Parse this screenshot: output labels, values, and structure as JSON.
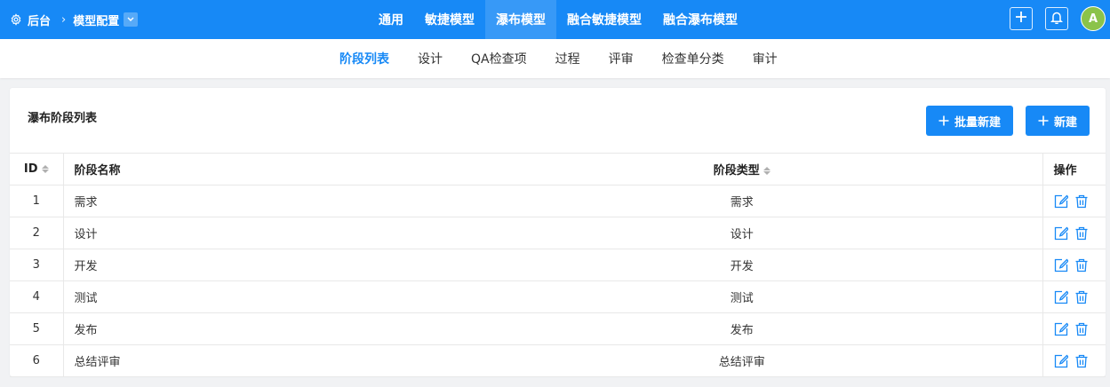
{
  "breadcrumb": {
    "home": "后台",
    "current": "模型配置"
  },
  "topnav": {
    "items": [
      "通用",
      "敏捷模型",
      "瀑布模型",
      "融合敏捷模型",
      "融合瀑布模型"
    ],
    "active_index": 2
  },
  "user": {
    "avatar_initial": "A"
  },
  "subnav": {
    "tabs": [
      "阶段列表",
      "设计",
      "QA检查项",
      "过程",
      "评审",
      "检查单分类",
      "审计"
    ],
    "active_index": 0
  },
  "card": {
    "title": "瀑布阶段列表",
    "batch_create_label": "批量新建",
    "create_label": "新建"
  },
  "table": {
    "columns": {
      "id": "ID",
      "name": "阶段名称",
      "type": "阶段类型",
      "ops": "操作"
    },
    "rows": [
      {
        "id": "1",
        "name": "需求",
        "type": "需求"
      },
      {
        "id": "2",
        "name": "设计",
        "type": "设计"
      },
      {
        "id": "3",
        "name": "开发",
        "type": "开发"
      },
      {
        "id": "4",
        "name": "测试",
        "type": "测试"
      },
      {
        "id": "5",
        "name": "发布",
        "type": "发布"
      },
      {
        "id": "6",
        "name": "总结评审",
        "type": "总结评审"
      }
    ]
  },
  "colors": {
    "primary": "#1789f6",
    "avatar": "#8bc34a",
    "icon": "#1789f6"
  },
  "icons": {
    "settings": "gear-icon",
    "add": "plus-icon",
    "notifications": "bell-icon",
    "edit": "edit-icon",
    "delete": "trash-icon"
  }
}
